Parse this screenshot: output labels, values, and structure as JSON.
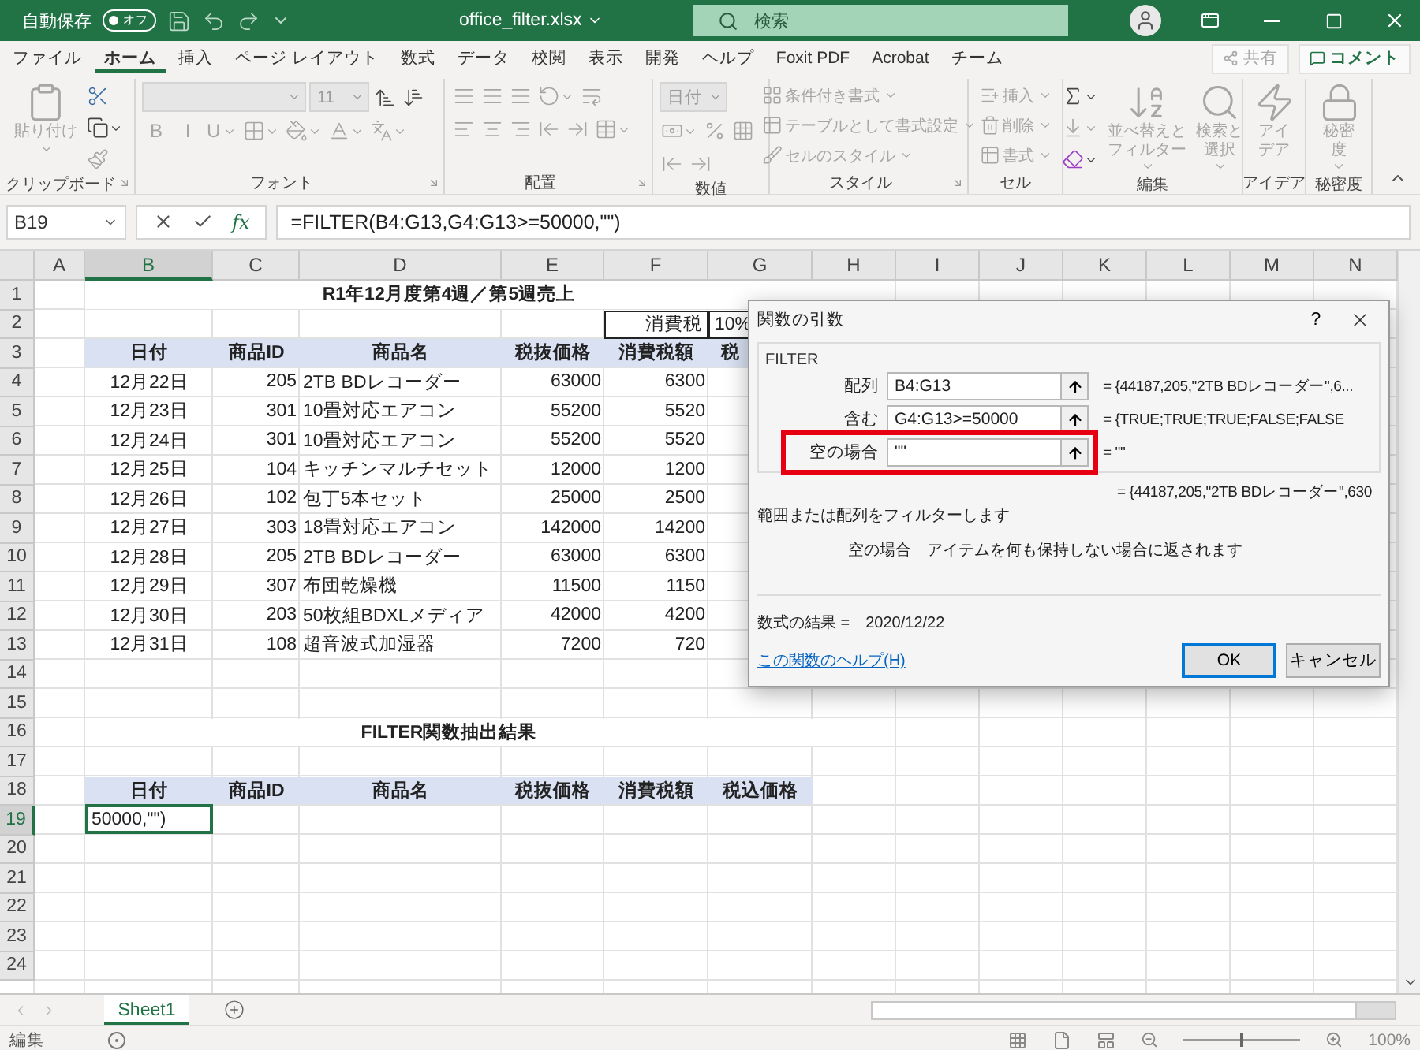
{
  "title_bar": {
    "autosave_label": "自動保存",
    "autosave": {
      "on": false,
      "label": "オフ"
    },
    "filename": "office_filter.xlsx",
    "search_placeholder": "検索"
  },
  "menu_tabs": [
    {
      "label": "ファイル",
      "selected": false
    },
    {
      "label": "ホーム",
      "selected": true
    },
    {
      "label": "挿入",
      "selected": false
    },
    {
      "label": "ページ レイアウト",
      "selected": false
    },
    {
      "label": "数式",
      "selected": false
    },
    {
      "label": "データ",
      "selected": false
    },
    {
      "label": "校閲",
      "selected": false
    },
    {
      "label": "表示",
      "selected": false
    },
    {
      "label": "開発",
      "selected": false
    },
    {
      "label": "ヘルプ",
      "selected": false
    },
    {
      "label": "Foxit PDF",
      "selected": false
    },
    {
      "label": "Acrobat",
      "selected": false
    },
    {
      "label": "チーム",
      "selected": false
    }
  ],
  "share_button": {
    "label": "共有",
    "disabled": true
  },
  "comment_button": {
    "label": "コメント",
    "disabled": false
  },
  "ribbon": {
    "groups": [
      {
        "kind": "clipboard",
        "label": "クリップボード",
        "launcher": true,
        "stacks": [
          [
            {
              "kind": "large",
              "lines": [
                "貼り付け"
              ],
              "disabled": true,
              "menu": true
            }
          ],
          [
            {
              "kind": "icon",
              "disabled": false,
              "menu": false
            },
            {
              "kind": "icon",
              "disabled": false,
              "menu": true
            },
            {
              "kind": "icon",
              "disabled": true,
              "menu": false
            }
          ]
        ]
      },
      {
        "kind": "font",
        "label": "フォント",
        "launcher": true,
        "stacks": [
          [
            {
              "kind": "field",
              "disabled": true,
              "menu": true
            },
            {
              "kind": "size-field",
              "value": "11",
              "disabled": true,
              "menu": true
            },
            {
              "kind": "icon",
              "disabled": false,
              "menu": false
            },
            {
              "kind": "icon",
              "disabled": false,
              "menu": false
            }
          ],
          [
            {
              "kind": "glyph",
              "text": "B",
              "disabled": true,
              "menu": false
            },
            {
              "kind": "glyph",
              "text": "I",
              "disabled": true,
              "menu": false
            },
            {
              "kind": "glyph",
              "text": "U",
              "disabled": true,
              "menu": true
            },
            {
              "kind": "icon",
              "disabled": true,
              "menu": true
            },
            {
              "kind": "icon",
              "disabled": true,
              "menu": true
            },
            {
              "kind": "icon",
              "disabled": true,
              "menu": true
            },
            {
              "kind": "icon",
              "disabled": true,
              "menu": true
            }
          ]
        ]
      },
      {
        "kind": "alignment",
        "label": "配置",
        "launcher": true,
        "stacks": [
          [
            {
              "kind": "icon",
              "disabled": true,
              "menu": false
            },
            {
              "kind": "icon",
              "disabled": true,
              "menu": false
            },
            {
              "kind": "icon",
              "disabled": true,
              "menu": false
            },
            {
              "kind": "icon",
              "disabled": true,
              "menu": true
            },
            {
              "kind": "icon",
              "disabled": true,
              "menu": false
            }
          ],
          [
            {
              "kind": "icon",
              "disabled": true,
              "menu": false
            },
            {
              "kind": "icon",
              "disabled": true,
              "menu": false
            },
            {
              "kind": "icon",
              "disabled": true,
              "menu": false
            },
            {
              "kind": "icon",
              "disabled": true,
              "menu": false
            },
            {
              "kind": "icon",
              "disabled": true,
              "menu": false
            },
            {
              "kind": "icon",
              "disabled": true,
              "menu": true
            }
          ]
        ]
      },
      {
        "kind": "number",
        "label": "数値",
        "launcher": false,
        "stacks": [
          [
            {
              "kind": "size-field",
              "value": "日付",
              "disabled": true,
              "menu": true
            }
          ],
          [
            {
              "kind": "icon",
              "disabled": true,
              "menu": true
            },
            {
              "kind": "icon",
              "disabled": true,
              "menu": false
            },
            {
              "kind": "icon",
              "disabled": true,
              "menu": false
            }
          ],
          [
            {
              "kind": "icon",
              "disabled": true,
              "menu": false
            },
            {
              "kind": "icon",
              "disabled": true,
              "menu": false
            }
          ]
        ]
      },
      {
        "kind": "styles",
        "label": "スタイル",
        "launcher": true,
        "stacks": [
          [
            {
              "kind": "small",
              "text": "条件付き書式",
              "disabled": true,
              "menu": true
            },
            {
              "kind": "small",
              "text": "テーブルとして書式設定",
              "disabled": true,
              "menu": true
            },
            {
              "kind": "small",
              "text": "セルのスタイル",
              "disabled": true,
              "menu": true
            }
          ]
        ]
      },
      {
        "kind": "cells",
        "label": "セル",
        "launcher": false,
        "stacks": [
          [
            {
              "kind": "small",
              "text": "挿入",
              "disabled": true,
              "menu": true
            },
            {
              "kind": "small",
              "text": "削除",
              "disabled": true,
              "menu": true
            },
            {
              "kind": "small",
              "text": "書式",
              "disabled": true,
              "menu": true
            }
          ]
        ]
      },
      {
        "kind": "editing",
        "label": "編集",
        "launcher": false,
        "stacks": [
          [
            {
              "kind": "icon",
              "disabled": false,
              "menu": true
            },
            {
              "kind": "icon",
              "disabled": true,
              "menu": true
            },
            {
              "kind": "icon",
              "disabled": false,
              "menu": true
            }
          ],
          [
            {
              "kind": "large",
              "lines": [
                "並べ替えと",
                "フィルター"
              ],
              "disabled": true,
              "menu": true
            }
          ],
          [
            {
              "kind": "large",
              "lines": [
                "検索と",
                "選択"
              ],
              "disabled": true,
              "menu": true
            }
          ]
        ]
      },
      {
        "kind": "ideas",
        "label": "アイデア",
        "launcher": false,
        "stacks": [
          [
            {
              "kind": "large",
              "lines": [
                "アイ",
                "デア"
              ],
              "disabled": true,
              "menu": false
            }
          ]
        ]
      },
      {
        "kind": "sensitivity",
        "label": "秘密度",
        "launcher": false,
        "stacks": [
          [
            {
              "kind": "large",
              "lines": [
                "秘密",
                "度"
              ],
              "disabled": true,
              "menu": true
            }
          ]
        ]
      }
    ]
  },
  "formula_bar": {
    "name_box": "B19",
    "insert_function": "fx",
    "formula": "=FILTER(B4:G13,G4:G13>=50000,\"\")"
  },
  "sheet": {
    "columns": [
      {
        "label": "A",
        "selected": false
      },
      {
        "label": "B",
        "selected": true
      },
      {
        "label": "C",
        "selected": false
      },
      {
        "label": "D",
        "selected": false
      },
      {
        "label": "E",
        "selected": false
      },
      {
        "label": "F",
        "selected": false
      },
      {
        "label": "G",
        "selected": false
      },
      {
        "label": "H",
        "selected": false
      },
      {
        "label": "I",
        "selected": false
      },
      {
        "label": "J",
        "selected": false
      },
      {
        "label": "K",
        "selected": false
      },
      {
        "label": "L",
        "selected": false
      },
      {
        "label": "M",
        "selected": false
      },
      {
        "label": "N",
        "selected": false
      }
    ],
    "rows": [
      {
        "number": "1",
        "kind": "title",
        "selected": false,
        "title": "R1年12月度第4週／第5週売上"
      },
      {
        "number": "2",
        "kind": "boxed",
        "selected": false,
        "cells": [
          "消費税",
          "10%"
        ]
      },
      {
        "number": "3",
        "kind": "header",
        "selected": false,
        "clipped": true,
        "cells": [
          "日付",
          "商品ID",
          "商品名",
          "税抜価格",
          "消費税額",
          "税"
        ]
      },
      {
        "number": "4",
        "kind": "data",
        "selected": false,
        "cells": [
          "12月22日",
          "205",
          "2TB BDレコーダー",
          "63000",
          "6300"
        ]
      },
      {
        "number": "5",
        "kind": "data",
        "selected": false,
        "cells": [
          "12月23日",
          "301",
          "10畳対応エアコン",
          "55200",
          "5520"
        ]
      },
      {
        "number": "6",
        "kind": "data",
        "selected": false,
        "cells": [
          "12月24日",
          "301",
          "10畳対応エアコン",
          "55200",
          "5520"
        ]
      },
      {
        "number": "7",
        "kind": "data",
        "selected": false,
        "cells": [
          "12月25日",
          "104",
          "キッチンマルチセット",
          "12000",
          "1200"
        ]
      },
      {
        "number": "8",
        "kind": "data",
        "selected": false,
        "cells": [
          "12月26日",
          "102",
          "包丁5本セット",
          "25000",
          "2500"
        ]
      },
      {
        "number": "9",
        "kind": "data",
        "selected": false,
        "cells": [
          "12月27日",
          "303",
          "18畳対応エアコン",
          "142000",
          "14200"
        ]
      },
      {
        "number": "10",
        "kind": "data",
        "selected": false,
        "cells": [
          "12月28日",
          "205",
          "2TB BDレコーダー",
          "63000",
          "6300"
        ]
      },
      {
        "number": "11",
        "kind": "data",
        "selected": false,
        "cells": [
          "12月29日",
          "307",
          "布団乾燥機",
          "11500",
          "1150"
        ]
      },
      {
        "number": "12",
        "kind": "data",
        "selected": false,
        "cells": [
          "12月30日",
          "203",
          "50枚組BDXLメディア",
          "42000",
          "4200"
        ]
      },
      {
        "number": "13",
        "kind": "data",
        "selected": false,
        "cells": [
          "12月31日",
          "108",
          "超音波式加湿器",
          "7200",
          "720"
        ]
      },
      {
        "number": "14",
        "kind": "data",
        "selected": false
      },
      {
        "number": "15",
        "kind": "data",
        "selected": false
      },
      {
        "number": "16",
        "kind": "title",
        "selected": false,
        "title": "FILTER関数抽出結果"
      },
      {
        "number": "17",
        "kind": "data",
        "selected": false
      },
      {
        "number": "18",
        "kind": "header",
        "selected": false,
        "clipped": false,
        "cells": [
          "日付",
          "商品ID",
          "商品名",
          "税抜価格",
          "消費税額",
          "税込価格"
        ]
      },
      {
        "number": "19",
        "kind": "data",
        "selected": true,
        "editing": true,
        "cells": [
          "50000,\"\")"
        ]
      },
      {
        "number": "20",
        "kind": "data",
        "selected": false
      },
      {
        "number": "21",
        "kind": "data",
        "selected": false
      },
      {
        "number": "22",
        "kind": "data",
        "selected": false
      },
      {
        "number": "23",
        "kind": "data",
        "selected": false
      },
      {
        "number": "24",
        "kind": "data",
        "selected": false
      }
    ]
  },
  "dialog": {
    "title": "関数の引数",
    "help_button": "?",
    "function": "FILTER",
    "arguments": [
      {
        "label": "配列",
        "value": "B4:G13",
        "result": "= {44187,205,\"2TB BDレコーダー\",6...",
        "highlighted": false
      },
      {
        "label": "含む",
        "value": "G4:G13>=50000",
        "result": "= {TRUE;TRUE;TRUE;FALSE;FALSE",
        "highlighted": false
      },
      {
        "label": "空の場合",
        "value": "\"\"",
        "result": "= \"\"",
        "highlighted": true
      }
    ],
    "overall_result": "= {44187,205,\"2TB BDレコーダー\",630",
    "description": "範囲または配列をフィルターします",
    "argument_help": {
      "name": "空の場合",
      "text": "アイテムを何も保持しない場合に返されます"
    },
    "formula_result": {
      "label": "数式の結果 =",
      "value": "2020/12/22"
    },
    "help_link": "この関数のヘルプ(H)",
    "buttons": [
      {
        "label": "OK",
        "default": true
      },
      {
        "label": "キャンセル",
        "default": false
      }
    ]
  },
  "sheet_tabs": [
    {
      "label": "Sheet1",
      "selected": true
    }
  ],
  "status_bar": {
    "mode": "編集",
    "zoom": {
      "level": 0.5,
      "reading": "100%"
    }
  }
}
